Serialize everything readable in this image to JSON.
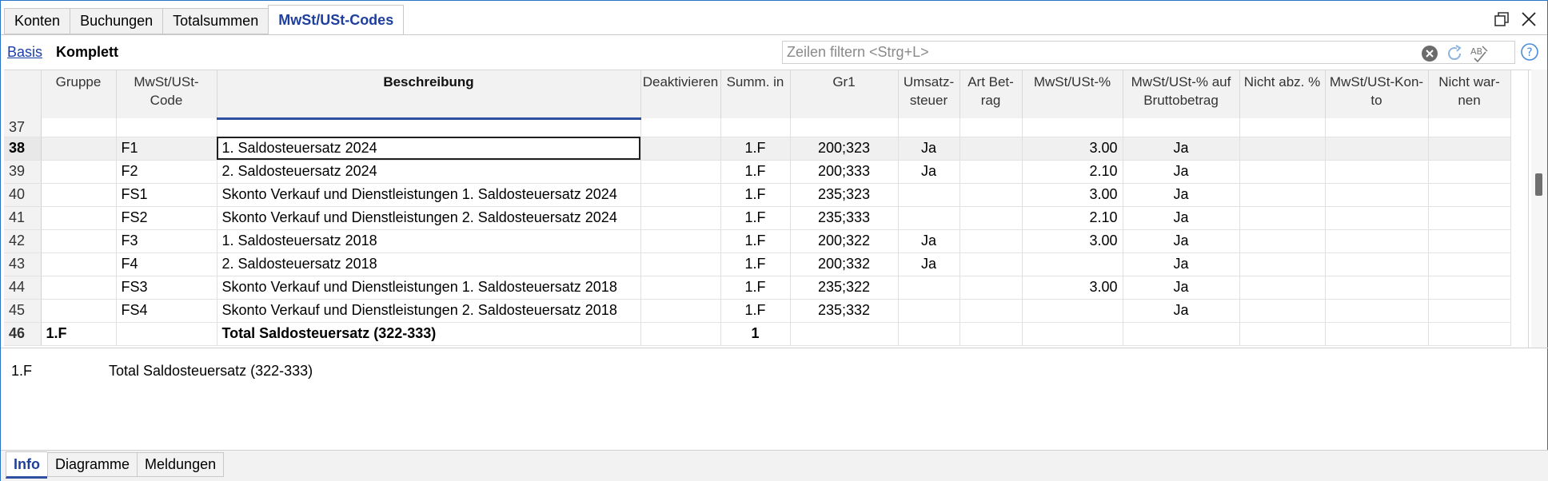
{
  "top_tabs": [
    "Konten",
    "Buchungen",
    "Totalsummen",
    "MwSt/USt-Codes"
  ],
  "view": {
    "basis": "Basis",
    "komplett": "Komplett"
  },
  "filter": {
    "placeholder": "Zeilen filtern <Strg+L>"
  },
  "icons": {
    "restore": "window-restore-icon",
    "close": "close-window-icon",
    "clear": "clear-filter-icon",
    "refresh": "refresh-icon",
    "spellcheck": "spellcheck-icon",
    "help": "help-icon"
  },
  "columns": [
    "",
    "Gruppe",
    "MwSt/USt-\nCode",
    "Beschreibung",
    "Deaktivieren",
    "Summ. in",
    "Gr1",
    "Umsatz-\nsteuer",
    "Art Bet-\nrag",
    "MwSt/USt-%",
    "MwSt/USt-% auf\nBruttobetrag",
    "Nicht abz. %",
    "MwSt/USt-Kon-\nto",
    "Nicht war-\nnen"
  ],
  "rows": [
    {
      "n": "37",
      "grp": "",
      "code": "",
      "desc": "",
      "deakt": "",
      "summ": "",
      "gr1": "",
      "ust": "",
      "art": "",
      "pct": "",
      "brutto": "",
      "nabz": "",
      "konto": "",
      "nw": ""
    },
    {
      "n": "38",
      "grp": "",
      "code": "F1",
      "desc": "1. Saldosteuersatz 2024",
      "deakt": "",
      "summ": "1.F",
      "gr1": "200;323",
      "ust": "Ja",
      "art": "",
      "pct": "3.00",
      "brutto": "Ja",
      "nabz": "",
      "konto": "",
      "nw": ""
    },
    {
      "n": "39",
      "grp": "",
      "code": "F2",
      "desc": "2. Saldosteuersatz 2024",
      "deakt": "",
      "summ": "1.F",
      "gr1": "200;333",
      "ust": "Ja",
      "art": "",
      "pct": "2.10",
      "brutto": "Ja",
      "nabz": "",
      "konto": "",
      "nw": ""
    },
    {
      "n": "40",
      "grp": "",
      "code": "FS1",
      "desc": "Skonto Verkauf und Dienstleistungen 1. Saldosteuersatz 2024",
      "deakt": "",
      "summ": "1.F",
      "gr1": "235;323",
      "ust": "",
      "art": "",
      "pct": "3.00",
      "brutto": "Ja",
      "nabz": "",
      "konto": "",
      "nw": ""
    },
    {
      "n": "41",
      "grp": "",
      "code": "FS2",
      "desc": "Skonto Verkauf und Dienstleistungen 2. Saldosteuersatz 2024",
      "deakt": "",
      "summ": "1.F",
      "gr1": "235;333",
      "ust": "",
      "art": "",
      "pct": "2.10",
      "brutto": "Ja",
      "nabz": "",
      "konto": "",
      "nw": ""
    },
    {
      "n": "42",
      "grp": "",
      "code": "F3",
      "desc": "1. Saldosteuersatz 2018",
      "deakt": "",
      "summ": "1.F",
      "gr1": "200;322",
      "ust": "Ja",
      "art": "",
      "pct": "3.00",
      "brutto": "Ja",
      "nabz": "",
      "konto": "",
      "nw": ""
    },
    {
      "n": "43",
      "grp": "",
      "code": "F4",
      "desc": "2. Saldosteuersatz 2018",
      "deakt": "",
      "summ": "1.F",
      "gr1": "200;332",
      "ust": "Ja",
      "art": "",
      "pct": "",
      "brutto": "Ja",
      "nabz": "",
      "konto": "",
      "nw": ""
    },
    {
      "n": "44",
      "grp": "",
      "code": "FS3",
      "desc": "Skonto Verkauf und Dienstleistungen 1. Saldosteuersatz 2018",
      "deakt": "",
      "summ": "1.F",
      "gr1": "235;322",
      "ust": "",
      "art": "",
      "pct": "3.00",
      "brutto": "Ja",
      "nabz": "",
      "konto": "",
      "nw": ""
    },
    {
      "n": "45",
      "grp": "",
      "code": "FS4",
      "desc": "Skonto Verkauf und Dienstleistungen 2. Saldosteuersatz 2018",
      "deakt": "",
      "summ": "1.F",
      "gr1": "235;332",
      "ust": "",
      "art": "",
      "pct": "",
      "brutto": "Ja",
      "nabz": "",
      "konto": "",
      "nw": ""
    },
    {
      "n": "46",
      "grp": "1.F",
      "code": "",
      "desc": "Total Saldosteuersatz (322-333)",
      "deakt": "",
      "summ": "1",
      "gr1": "",
      "ust": "",
      "art": "",
      "pct": "",
      "brutto": "",
      "nabz": "",
      "konto": "",
      "nw": ""
    }
  ],
  "info": {
    "code": "1.F",
    "desc": "Total Saldosteuersatz (322-333)"
  },
  "bottom_tabs": [
    "Info",
    "Diagramme",
    "Meldungen"
  ]
}
